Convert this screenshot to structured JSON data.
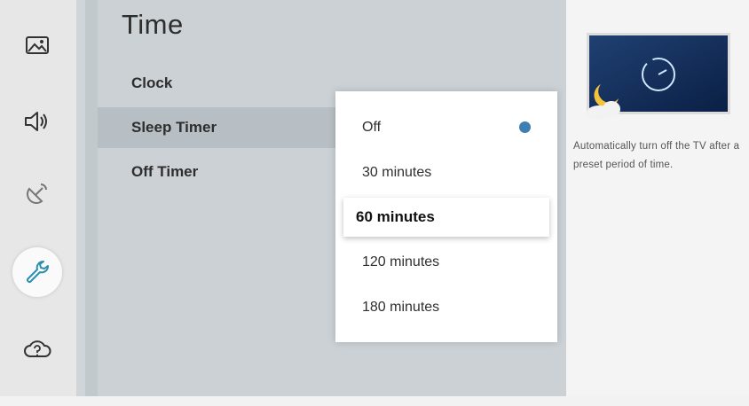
{
  "sidebar": {
    "icons": [
      {
        "name": "picture-icon",
        "active": false
      },
      {
        "name": "sound-icon",
        "active": false
      },
      {
        "name": "broadcasting-icon",
        "active": false
      },
      {
        "name": "general-wrench-icon",
        "active": true
      },
      {
        "name": "support-cloud-icon",
        "active": false
      }
    ]
  },
  "page": {
    "title": "Time"
  },
  "menu": {
    "items": [
      {
        "label": "Clock"
      },
      {
        "label": "Sleep Timer"
      },
      {
        "label": "Off Timer"
      }
    ]
  },
  "dropdown": {
    "options": [
      {
        "label": "Off",
        "checked": true
      },
      {
        "label": "30 minutes"
      },
      {
        "label": "60 minutes",
        "focused": true
      },
      {
        "label": "120 minutes"
      },
      {
        "label": "180 minutes"
      }
    ],
    "check_color": "#3d7fb2"
  },
  "help": {
    "description": "Automatically turn off the TV after a preset period of time.",
    "preview_icons": [
      "clock-icon",
      "moon-cloud-icon"
    ]
  },
  "colors": {
    "panel": "#cbd1d5",
    "selected_row": "#b7bfc4",
    "accent_icon": "#2a8fb0"
  }
}
